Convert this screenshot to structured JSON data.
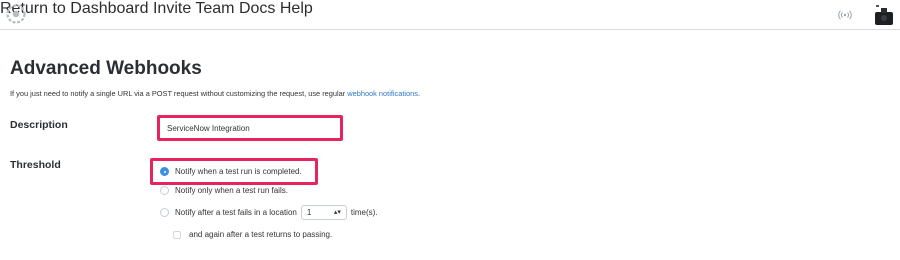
{
  "nav": {
    "return": "Return to Dashboard",
    "invite": "Invite Team",
    "docs": "Docs",
    "help": "Help"
  },
  "page": {
    "title": "Advanced Webhooks",
    "intro_prefix": "If you just need to notify a single URL via a POST request without customizing the request, use regular ",
    "intro_link": "webhook notifications",
    "intro_suffix": "."
  },
  "description": {
    "label": "Description",
    "value": "ServiceNow Integration"
  },
  "threshold": {
    "label": "Threshold",
    "options": [
      {
        "label": "Notify when a test run is completed.",
        "checked": true
      },
      {
        "label": "Notify only when a test run fails.",
        "checked": false
      },
      {
        "label_prefix": "Notify after a test fails in a location",
        "count": "1",
        "label_suffix": "time(s).",
        "checked": false
      }
    ],
    "again_label": "and again after a test returns to passing."
  },
  "colors": {
    "highlight": "#e8245f",
    "accent": "#3d8ee6",
    "link": "#2e76c3"
  }
}
